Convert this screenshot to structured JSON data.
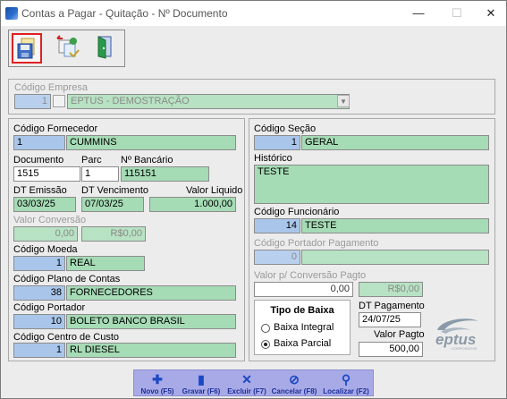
{
  "window": {
    "title": "Contas a Pagar - Quitação - Nº Documento",
    "min_glyph": "—",
    "max_glyph": "☐",
    "close_glyph": "✕"
  },
  "toolbar": {
    "buttons": [
      {
        "name": "save-disk-icon",
        "selected": true
      },
      {
        "name": "refresh-exchange-icon",
        "selected": false
      },
      {
        "name": "exit-door-icon",
        "selected": false
      }
    ]
  },
  "empresa": {
    "label": "Código Empresa",
    "code": "1",
    "name": "EPTUS - DEMOSTRAÇÃO"
  },
  "fornecedor": {
    "label": "Código Fornecedor",
    "code": "1",
    "name": "CUMMINS"
  },
  "documento": {
    "label": "Documento",
    "value": "1515"
  },
  "parc": {
    "label": "Parc",
    "value": "1"
  },
  "nbancario": {
    "label": "Nº Bancário",
    "value": "115151"
  },
  "dt_emissao": {
    "label": "DT Emissão",
    "value": "03/03/25"
  },
  "dt_vencimento": {
    "label": "DT Vencimento",
    "value": "07/03/25"
  },
  "valor_liquido": {
    "label": "Valor Liquido",
    "value": "1.000,00"
  },
  "valor_conversao": {
    "label": "Valor Conversão",
    "value": "0,00",
    "value2": "R$0,00"
  },
  "moeda": {
    "label": "Código Moeda",
    "code": "1",
    "name": "REAL"
  },
  "plano_contas": {
    "label": "Código Plano de Contas",
    "code": "38",
    "name": "FORNECEDORES"
  },
  "portador": {
    "label": "Código Portador",
    "code": "10",
    "name": "BOLETO BANCO BRASIL"
  },
  "centro_custo": {
    "label": "Código Centro de Custo",
    "code": "1",
    "name": "RL DIESEL"
  },
  "secao": {
    "label": "Código Seção",
    "code": "1",
    "name": "GERAL"
  },
  "historico": {
    "label": "Histórico",
    "value": "TESTE"
  },
  "funcionario": {
    "label": "Código Funcionário",
    "code": "14",
    "name": "TESTE"
  },
  "portador_pagamento": {
    "label": "Código Portador Pagamento",
    "code": "0",
    "name": ""
  },
  "valor_conv_pagto": {
    "label": "Valor p/ Conversão Pagto",
    "value": "0,00",
    "value2": "R$0,00"
  },
  "tipo_baixa": {
    "title": "Tipo de Baixa",
    "options": [
      {
        "label": "Baixa Integral",
        "checked": false
      },
      {
        "label": "Baixa Parcial",
        "checked": true
      }
    ]
  },
  "dt_pagamento": {
    "label": "DT Pagamento",
    "value": "24/07/25"
  },
  "valor_pagto": {
    "label": "Valor Pagto",
    "value": "500,00"
  },
  "logo": {
    "text": "eptus",
    "subtext": "CORPORATIVE"
  },
  "bottom_actions": [
    {
      "label": "Novo (F5)",
      "icon": "plus-icon",
      "glyph": "✚"
    },
    {
      "label": "Gravar (F6)",
      "icon": "save-icon",
      "glyph": "▮"
    },
    {
      "label": "Excluir (F7)",
      "icon": "delete-x-icon",
      "glyph": "✕"
    },
    {
      "label": "Cancelar (F8)",
      "icon": "cancel-icon",
      "glyph": "⊘"
    },
    {
      "label": "Localizar (F2)",
      "icon": "search-icon",
      "glyph": "⚲"
    }
  ],
  "colors": {
    "code_field": "#a9c6ea",
    "name_field": "#a5dbb5",
    "action_bar": "#a7aae6",
    "selected_outline": "#e02020"
  }
}
